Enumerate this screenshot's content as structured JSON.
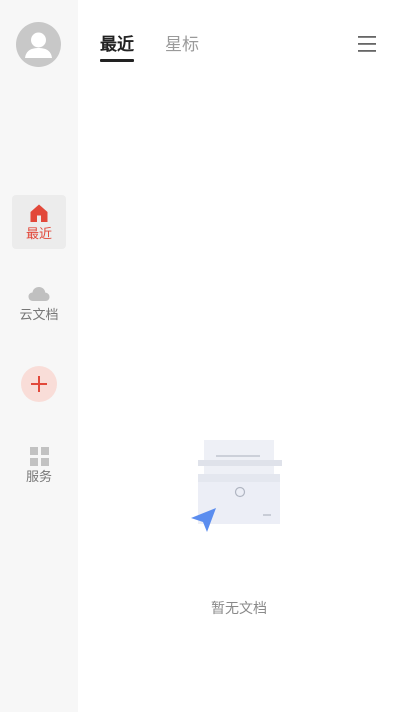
{
  "sidebar": {
    "avatar_icon": "user-avatar-icon",
    "items": [
      {
        "label": "最近",
        "icon": "home-icon",
        "active": true
      },
      {
        "label": "云文档",
        "icon": "cloud-icon",
        "active": false
      },
      {
        "label": "服务",
        "icon": "grid-icon",
        "active": false
      }
    ],
    "add_icon": "plus-icon"
  },
  "header": {
    "tabs": [
      {
        "label": "最近",
        "active": true
      },
      {
        "label": "星标",
        "active": false
      }
    ],
    "menu_icon": "menu-icon"
  },
  "main": {
    "empty_text": "暂无文档",
    "empty_icon": "empty-documents-icon"
  },
  "colors": {
    "accent": "#e2483a",
    "sidebar_bg": "#f7f7f7",
    "add_button_bg": "#f9ddd8",
    "illustration_blue": "#5b8def"
  }
}
